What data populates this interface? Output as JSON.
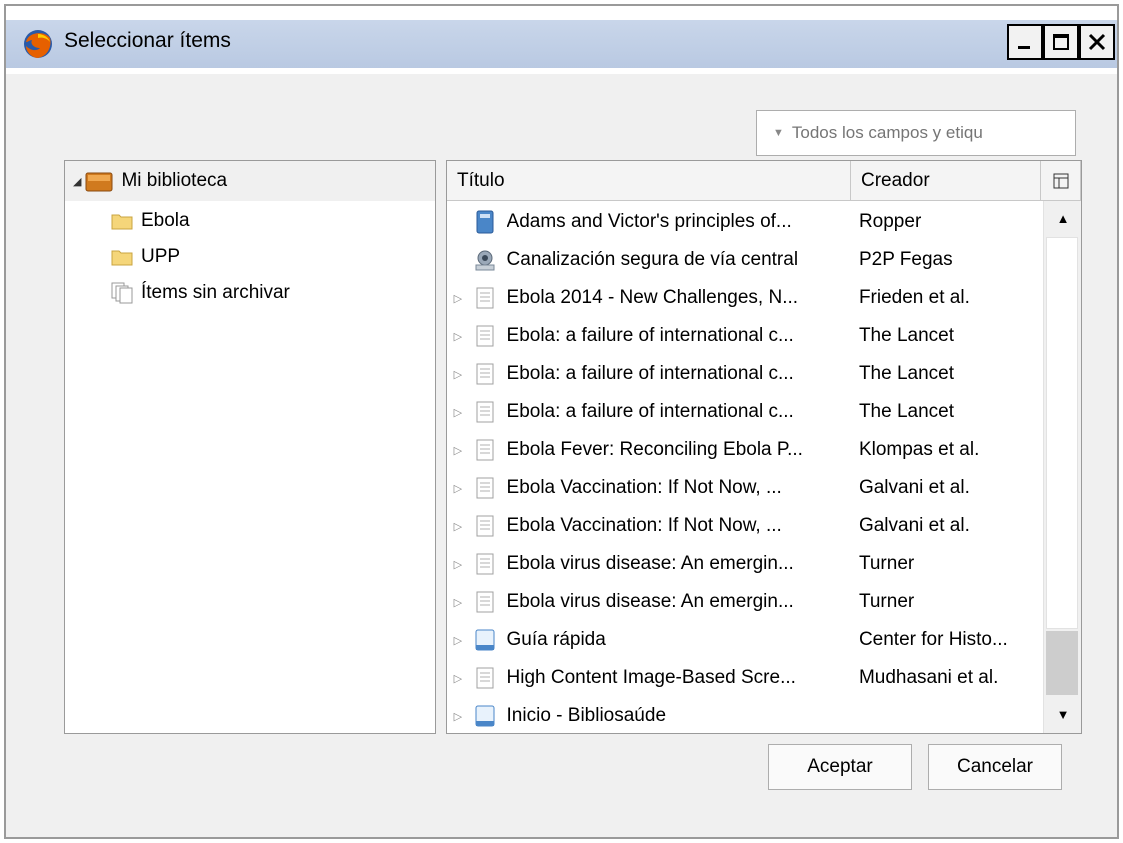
{
  "window": {
    "title": "Seleccionar ítems"
  },
  "search": {
    "placeholder": "Todos los campos y etiqu"
  },
  "tree": {
    "root_label": "Mi biblioteca",
    "items": [
      {
        "label": "Ebola",
        "icon": "folder-icon"
      },
      {
        "label": "UPP",
        "icon": "folder-icon"
      },
      {
        "label": "Ítems sin archivar",
        "icon": "unfiled-items-icon"
      }
    ]
  },
  "columns": {
    "title": "Título",
    "creator": "Creador"
  },
  "rows": [
    {
      "title": "Adams and Victor's principles of...",
      "creator": "Ropper",
      "icon": "book-icon",
      "expandable": false
    },
    {
      "title": "Canalización segura de vía central",
      "creator": "P2P Fegas",
      "icon": "video-icon",
      "expandable": false
    },
    {
      "title": "Ebola 2014 - New Challenges, N...",
      "creator": "Frieden et al.",
      "icon": "article-icon",
      "expandable": true
    },
    {
      "title": "Ebola: a failure of international c...",
      "creator": "The Lancet",
      "icon": "article-icon",
      "expandable": true
    },
    {
      "title": "Ebola: a failure of international c...",
      "creator": "The Lancet",
      "icon": "article-icon",
      "expandable": true
    },
    {
      "title": "Ebola: a failure of international c...",
      "creator": "The Lancet",
      "icon": "article-icon",
      "expandable": true
    },
    {
      "title": "Ebola Fever: Reconciling Ebola P...",
      "creator": "Klompas et al.",
      "icon": "article-icon",
      "expandable": true
    },
    {
      "title": "Ebola Vaccination: If Not Now, ...",
      "creator": "Galvani et al.",
      "icon": "article-icon",
      "expandable": true
    },
    {
      "title": "Ebola Vaccination: If Not Now, ...",
      "creator": "Galvani et al.",
      "icon": "article-icon",
      "expandable": true
    },
    {
      "title": "Ebola virus disease: An emergin...",
      "creator": "Turner",
      "icon": "article-icon",
      "expandable": true
    },
    {
      "title": "Ebola virus disease: An emergin...",
      "creator": "Turner",
      "icon": "article-icon",
      "expandable": true
    },
    {
      "title": "Guía rápida",
      "creator": "Center for Histo...",
      "icon": "webpage-icon",
      "expandable": true
    },
    {
      "title": "High Content Image-Based Scre...",
      "creator": "Mudhasani et al.",
      "icon": "article-icon",
      "expandable": true
    },
    {
      "title": "Inicio - Bibliosaúde",
      "creator": "",
      "icon": "webpage-icon",
      "expandable": true
    }
  ],
  "buttons": {
    "ok": "Aceptar",
    "cancel": "Cancelar"
  }
}
